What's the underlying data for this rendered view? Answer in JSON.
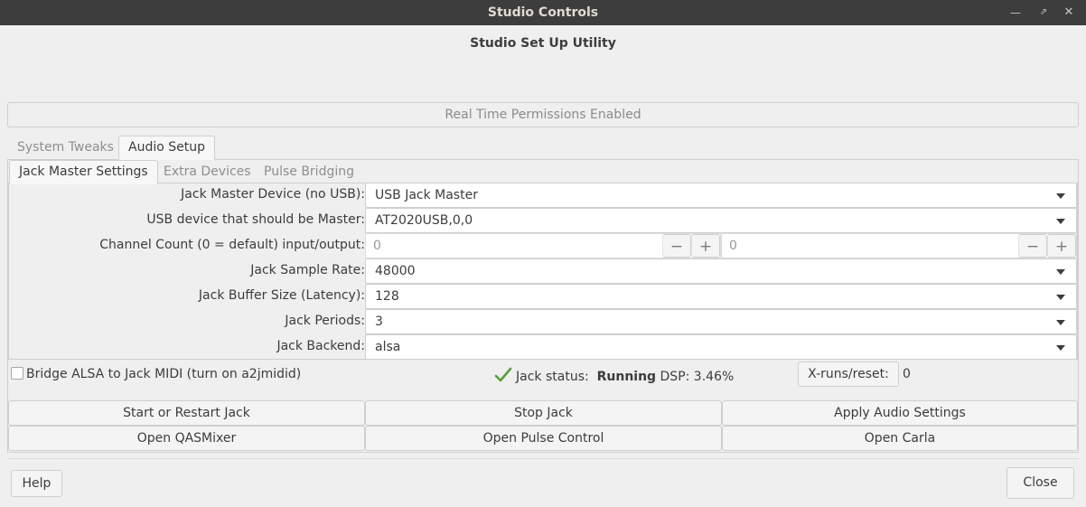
{
  "window": {
    "title": "Studio Controls"
  },
  "heading": "Studio Set Up Utility",
  "rt_permissions": "Real Time Permissions Enabled",
  "outer_tabs": [
    {
      "label": "System Tweaks",
      "active": false
    },
    {
      "label": "Audio Setup",
      "active": true
    }
  ],
  "inner_tabs": [
    {
      "label": "Jack Master Settings",
      "active": true
    },
    {
      "label": "Extra Devices",
      "active": false
    },
    {
      "label": "Pulse Bridging",
      "active": false
    }
  ],
  "settings": {
    "master_device": {
      "label": "Jack Master Device (no USB):",
      "value": "USB Jack Master"
    },
    "usb_master": {
      "label": "USB device that should be Master:",
      "value": "AT2020USB,0,0"
    },
    "channel_count": {
      "label": "Channel Count (0 = default) input/output:",
      "input": "0",
      "output": "0",
      "minus": "−",
      "plus": "+"
    },
    "sample_rate": {
      "label": "Jack Sample Rate:",
      "value": "48000"
    },
    "buffer_size": {
      "label": "Jack Buffer Size (Latency):",
      "value": "128"
    },
    "periods": {
      "label": "Jack Periods:",
      "value": "3"
    },
    "backend": {
      "label": "Jack Backend:",
      "value": "alsa"
    }
  },
  "bridge_midi": {
    "label": "Bridge ALSA to Jack MIDI (turn on a2jmidid)",
    "checked": false
  },
  "status": {
    "prefix": "Jack status:",
    "state": "Running",
    "dsp": "DSP: 3.46%",
    "icon": "checkmark-icon",
    "icon_color": "#5aa03a"
  },
  "xruns": {
    "button": "X-runs/reset:",
    "value": "0"
  },
  "actions": {
    "start": "Start or Restart  Jack",
    "stop": "Stop Jack",
    "apply": "Apply Audio Settings",
    "qasmixer": "Open QASMixer",
    "pulse_control": "Open Pulse Control",
    "carla": "Open Carla"
  },
  "footer": {
    "help": "Help",
    "close": "Close"
  }
}
